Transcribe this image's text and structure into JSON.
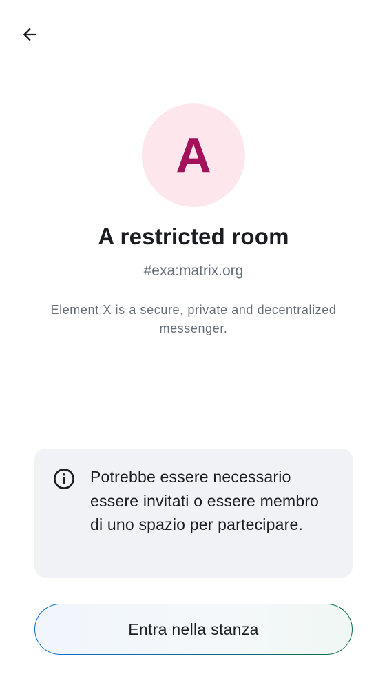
{
  "header": {
    "back_icon": "arrow-left-icon"
  },
  "room": {
    "avatar_letter": "A",
    "name": "A restricted room",
    "alias": "#exa:matrix.org",
    "topic": "Element X is a secure, private and decentralized messenger."
  },
  "notice": {
    "icon": "info-icon",
    "text": "Potrebbe essere necessario essere invitati o essere membro di uno spazio per partecipare."
  },
  "actions": {
    "join_label": "Entra nella stanza"
  },
  "colors": {
    "avatar_bg": "#fde6ec",
    "avatar_fg": "#a3115a",
    "notice_bg": "#f0f2f5",
    "secondary_text": "#656d77",
    "button_gradient_start": "#0a6bd1",
    "button_gradient_end": "#0d6b4a"
  }
}
